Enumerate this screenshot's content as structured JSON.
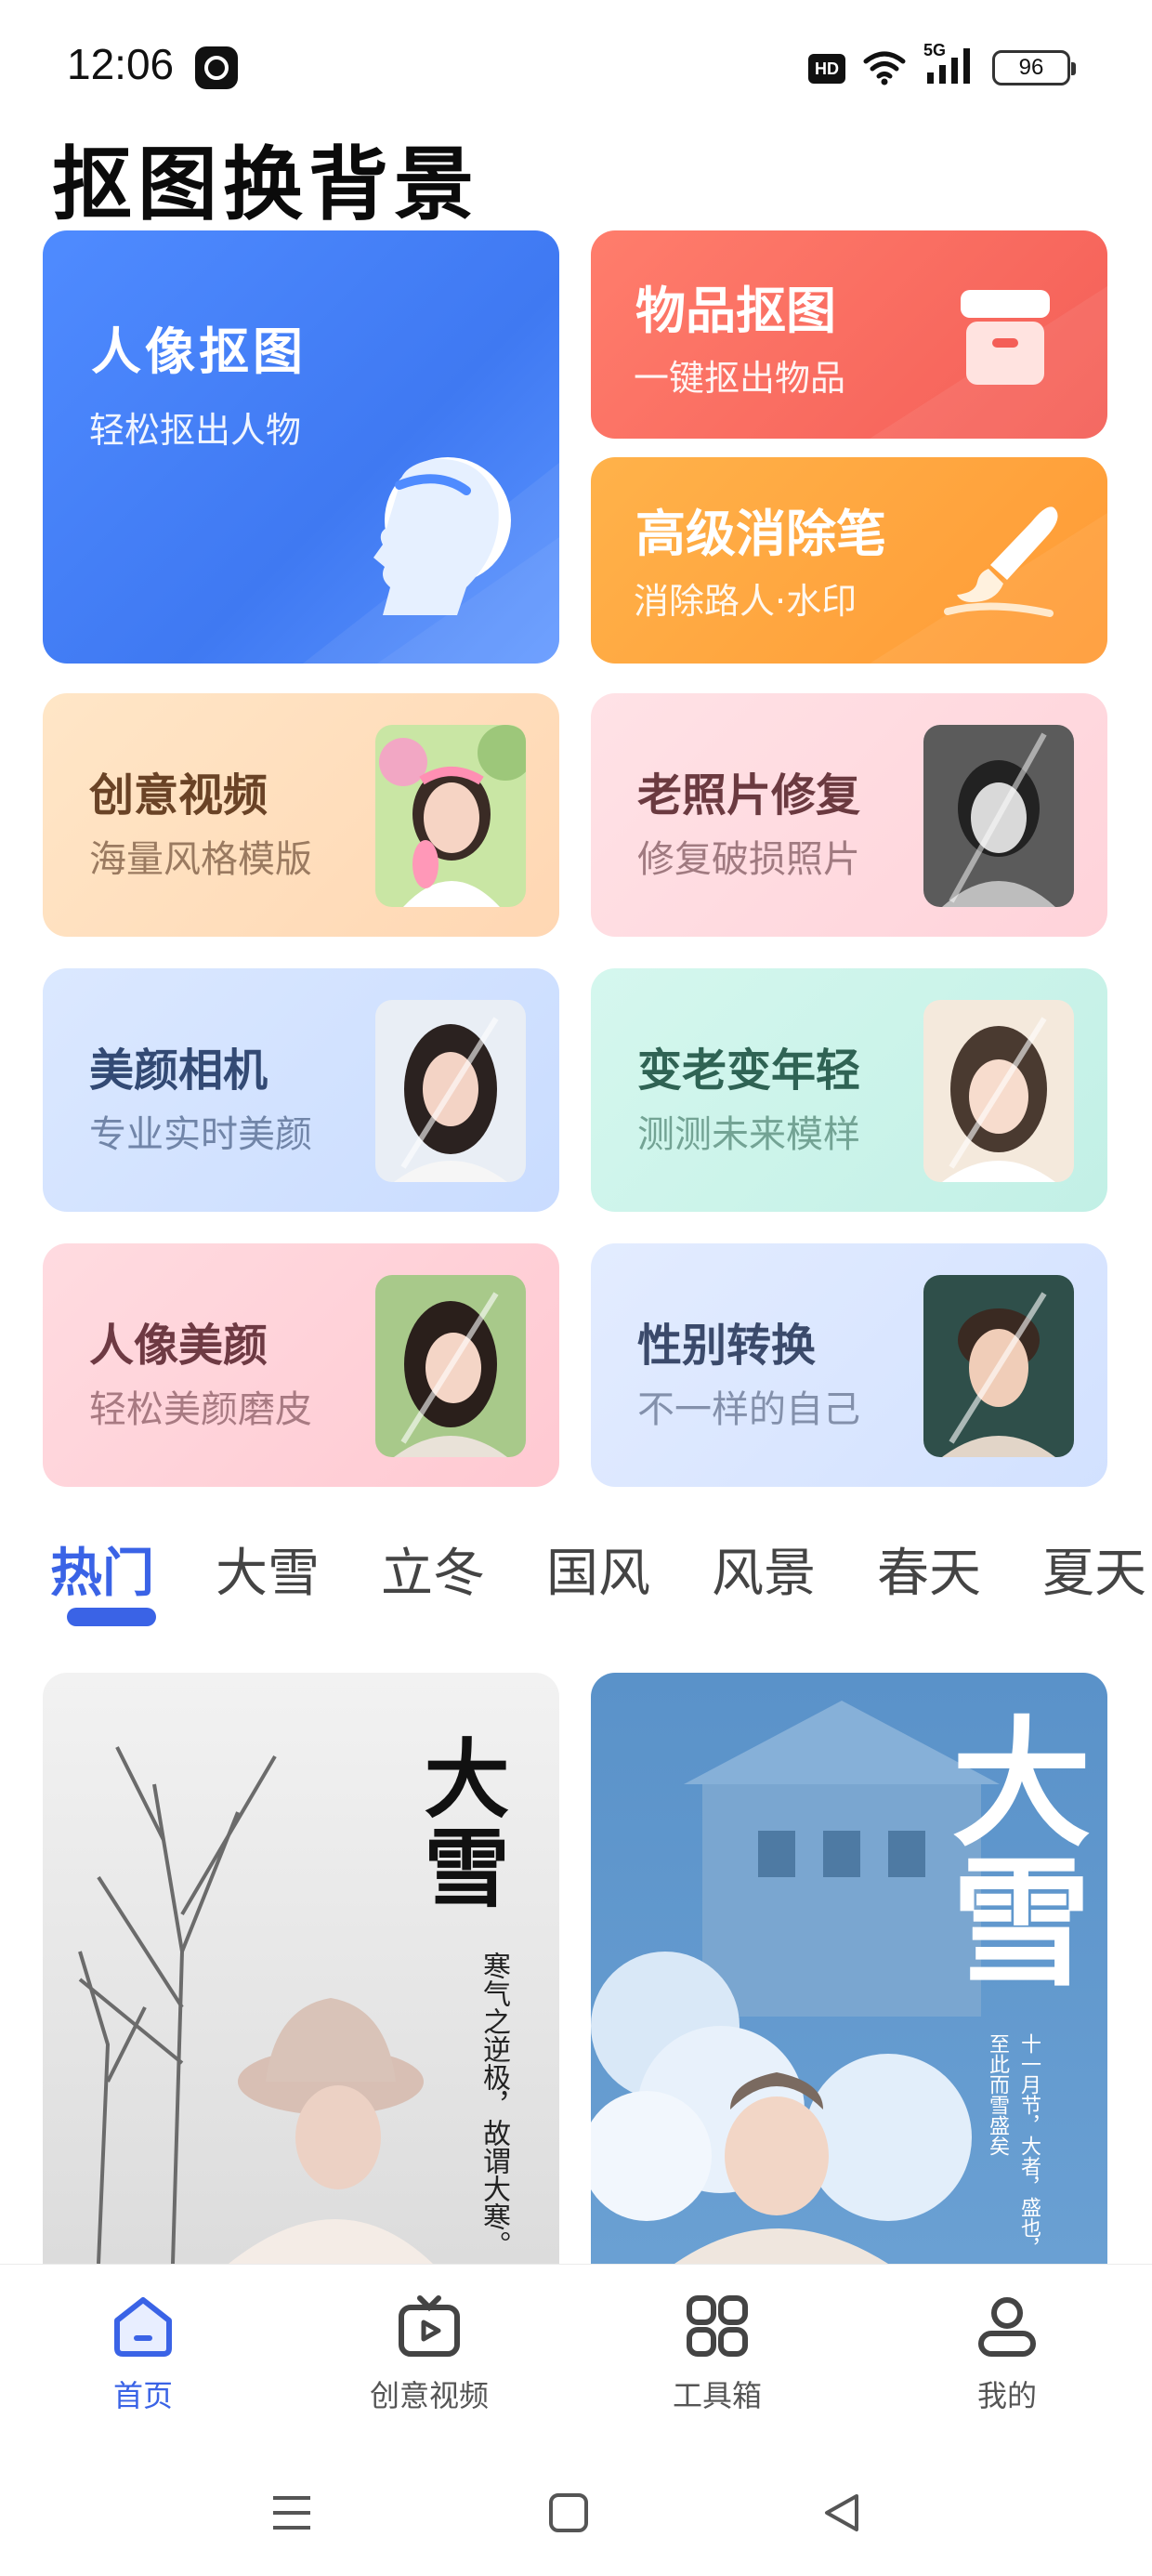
{
  "status": {
    "time": "12:06",
    "hd": "HD",
    "network": "5G",
    "battery": "96"
  },
  "page": {
    "title": "抠图换背景"
  },
  "features": {
    "portrait": {
      "title": "人像抠图",
      "subtitle": "轻松抠出人物"
    },
    "object": {
      "title": "物品抠图",
      "subtitle": "一键抠出物品"
    },
    "eraser": {
      "title": "高级消除笔",
      "subtitle": "消除路人·水印"
    }
  },
  "tiles": [
    {
      "title": "创意视频",
      "subtitle": "海量风格模版"
    },
    {
      "title": "老照片修复",
      "subtitle": "修复破损照片"
    },
    {
      "title": "美颜相机",
      "subtitle": "专业实时美颜"
    },
    {
      "title": "变老变年轻",
      "subtitle": "测测未来模样"
    },
    {
      "title": "人像美颜",
      "subtitle": "轻松美颜磨皮"
    },
    {
      "title": "性别转换",
      "subtitle": "不一样的自己"
    }
  ],
  "categories": [
    "热门",
    "大雪",
    "立冬",
    "国风",
    "风景",
    "春天",
    "夏天"
  ],
  "previews": [
    {
      "title": "大雪",
      "poem": "寒气之逆极，故谓大寒。"
    },
    {
      "title": "大雪",
      "poem": "十一月节，大者，盛也，至此而雪盛矣"
    }
  ],
  "bottom_nav": [
    {
      "label": "首页",
      "icon": "home-icon"
    },
    {
      "label": "创意视频",
      "icon": "video-play-icon"
    },
    {
      "label": "工具箱",
      "icon": "grid-icon"
    },
    {
      "label": "我的",
      "icon": "user-icon"
    }
  ],
  "colors": {
    "accent": "#3a63e6",
    "portrait_card": "#4f8bff",
    "object_card": "#f45e57",
    "eraser_card": "#ff9a35"
  }
}
